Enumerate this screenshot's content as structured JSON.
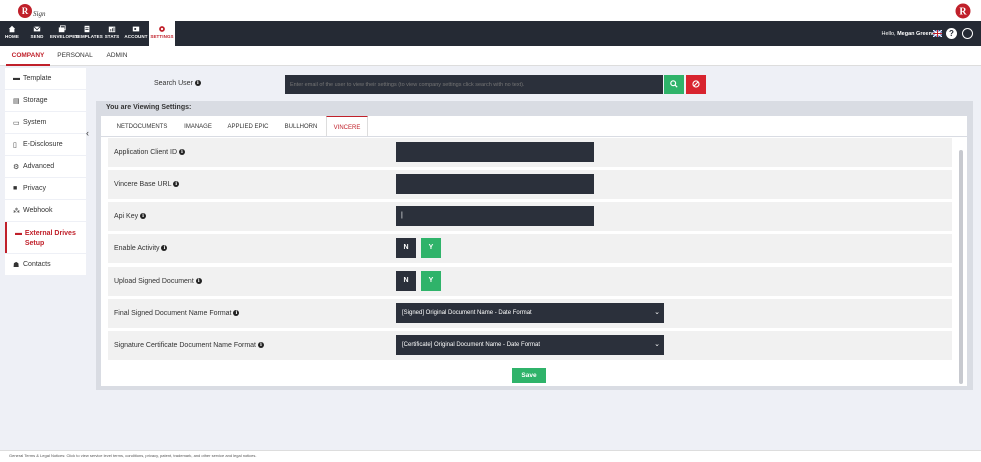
{
  "header": {
    "greeting_prefix": "Hello,",
    "user_name": "Megan Greene",
    "help_label": "?",
    "logo_text": "RSign",
    "brand_color": "#c0202a"
  },
  "nav": {
    "items": [
      {
        "label": "HOME",
        "icon": "home-icon"
      },
      {
        "label": "SEND",
        "icon": "envelope-icon"
      },
      {
        "label": "ENVELOPES",
        "icon": "envelopes-icon"
      },
      {
        "label": "TEMPLATES",
        "icon": "templates-icon"
      },
      {
        "label": "STATS",
        "icon": "stats-icon"
      },
      {
        "label": "ACCOUNT",
        "icon": "account-icon"
      },
      {
        "label": "SETTINGS",
        "icon": "gear-icon",
        "active": true
      }
    ]
  },
  "main_tabs": [
    {
      "label": "COMPANY",
      "active": true
    },
    {
      "label": "PERSONAL"
    },
    {
      "label": "ADMIN"
    }
  ],
  "sidebar": {
    "items": [
      {
        "label": "Template",
        "icon": "template-icon"
      },
      {
        "label": "Storage",
        "icon": "storage-icon"
      },
      {
        "label": "System",
        "icon": "monitor-icon"
      },
      {
        "label": "E-Disclosure",
        "icon": "document-icon"
      },
      {
        "label": "Advanced",
        "icon": "cogs-icon"
      },
      {
        "label": "Privacy",
        "icon": "lock-icon"
      },
      {
        "label": "Webhook",
        "icon": "webhook-icon"
      },
      {
        "label": "External Drives Setup",
        "icon": "drive-icon",
        "active": true
      },
      {
        "label": "Contacts",
        "icon": "contacts-icon"
      }
    ]
  },
  "search": {
    "label": "Search User",
    "placeholder": "Enter email of the user to view their settings (to view company settings click search with no text)."
  },
  "panel": {
    "title": "You are Viewing Settings:",
    "drive_tabs": [
      {
        "label": "NETDOCUMENTS"
      },
      {
        "label": "IMANAGE"
      },
      {
        "label": "APPLIED EPIC"
      },
      {
        "label": "BULLHORN"
      },
      {
        "label": "VINCERE",
        "active": true
      }
    ]
  },
  "form": {
    "client_id_label": "Application Client ID",
    "base_url_label": "Vincere Base URL",
    "api_key_label": "Api Key",
    "api_key_value": "|",
    "enable_activity_label": "Enable Activity",
    "upload_signed_label": "Upload Signed Document",
    "no_label": "N",
    "yes_label": "Y",
    "final_name_label": "Final Signed Document Name Format",
    "final_name_value": "[Signed] Original Document Name - Date Format",
    "cert_name_label": "Signature Certificate Document Name Format",
    "cert_name_value": "[Certificate] Original Document Name - Date Format",
    "save_label": "Save"
  },
  "footer": {
    "text": "General Terms & Legal Notices: Click to view service level terms, conditions, privacy, patent, trademark, and other service and legal notices."
  },
  "colors": {
    "accent": "#c0202a",
    "success": "#2fb36a",
    "dark_input": "#2b303b",
    "nav_bg": "#252a34"
  }
}
